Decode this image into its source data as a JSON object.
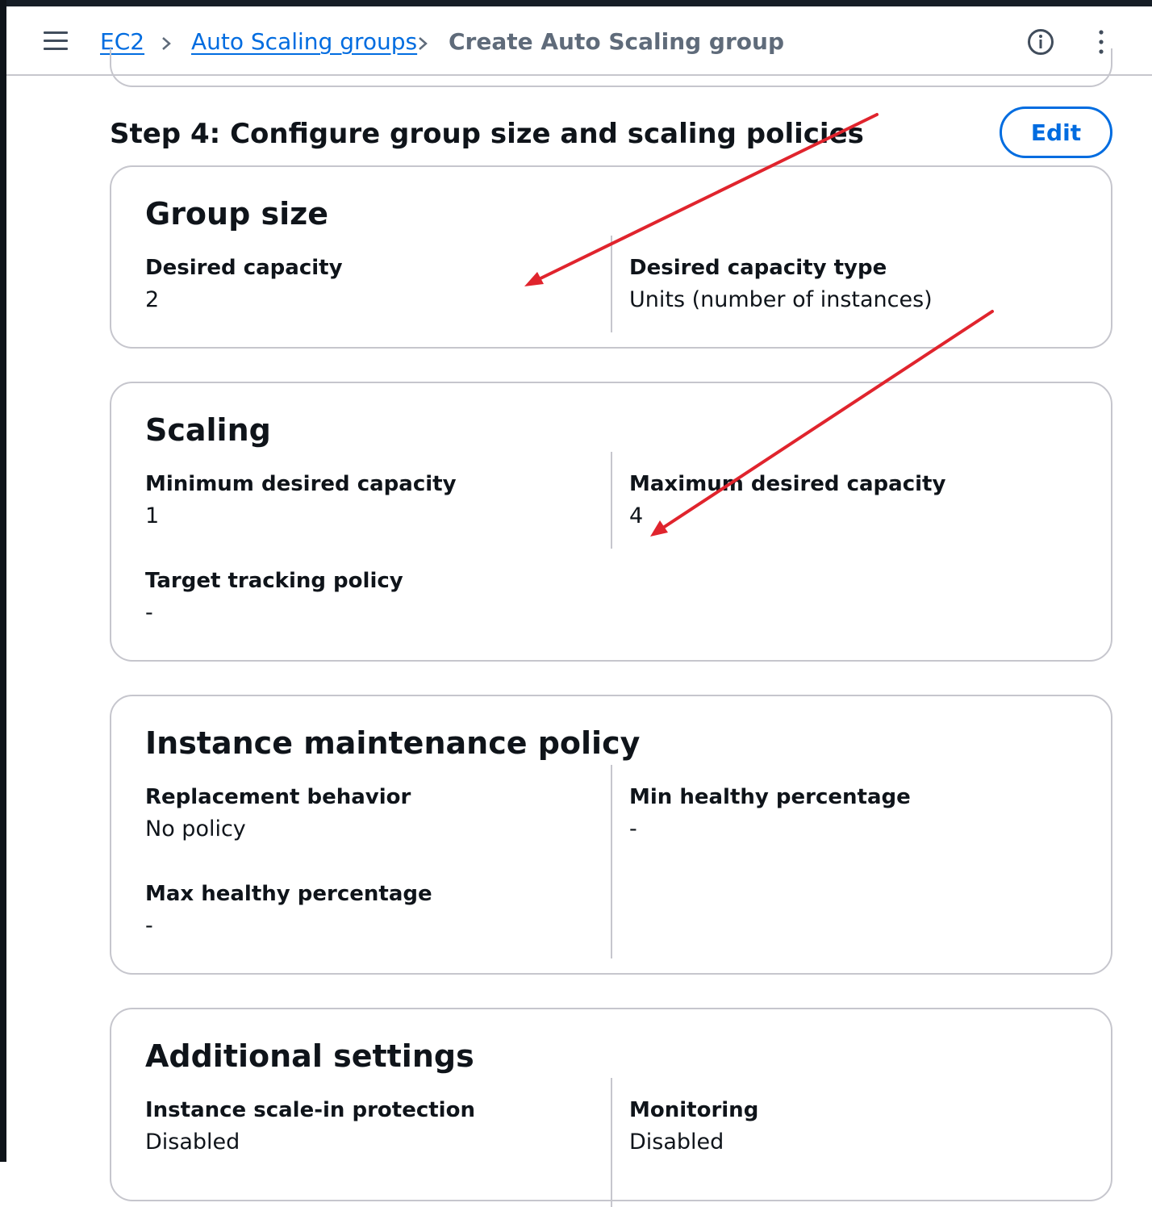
{
  "breadcrumb": {
    "items": [
      "EC2",
      "Auto Scaling groups"
    ],
    "current": "Create Auto Scaling group"
  },
  "step": {
    "title": "Step 4: Configure group size and scaling policies",
    "edit_label": "Edit"
  },
  "group_size": {
    "title": "Group size",
    "desired_capacity_label": "Desired capacity",
    "desired_capacity_value": "2",
    "desired_capacity_type_label": "Desired capacity type",
    "desired_capacity_type_value": "Units (number of instances)"
  },
  "scaling": {
    "title": "Scaling",
    "min_label": "Minimum desired capacity",
    "min_value": "1",
    "max_label": "Maximum desired capacity",
    "max_value": "4",
    "target_tracking_label": "Target tracking policy",
    "target_tracking_value": "-"
  },
  "maintenance": {
    "title": "Instance maintenance policy",
    "replacement_label": "Replacement behavior",
    "replacement_value": "No policy",
    "min_healthy_label": "Min healthy percentage",
    "min_healthy_value": "-",
    "max_healthy_label": "Max healthy percentage",
    "max_healthy_value": "-"
  },
  "additional": {
    "title": "Additional settings",
    "scale_in_label": "Instance scale-in protection",
    "scale_in_value": "Disabled",
    "monitoring_label": "Monitoring",
    "monitoring_value": "Disabled"
  },
  "colors": {
    "link": "#006ce0",
    "annotation_arrow": "#e0242d",
    "border": "#c6c6cd"
  },
  "icons": [
    "menu-icon",
    "chevron-right-icon",
    "info-icon",
    "more-vertical-icon",
    "annotation-arrow"
  ]
}
